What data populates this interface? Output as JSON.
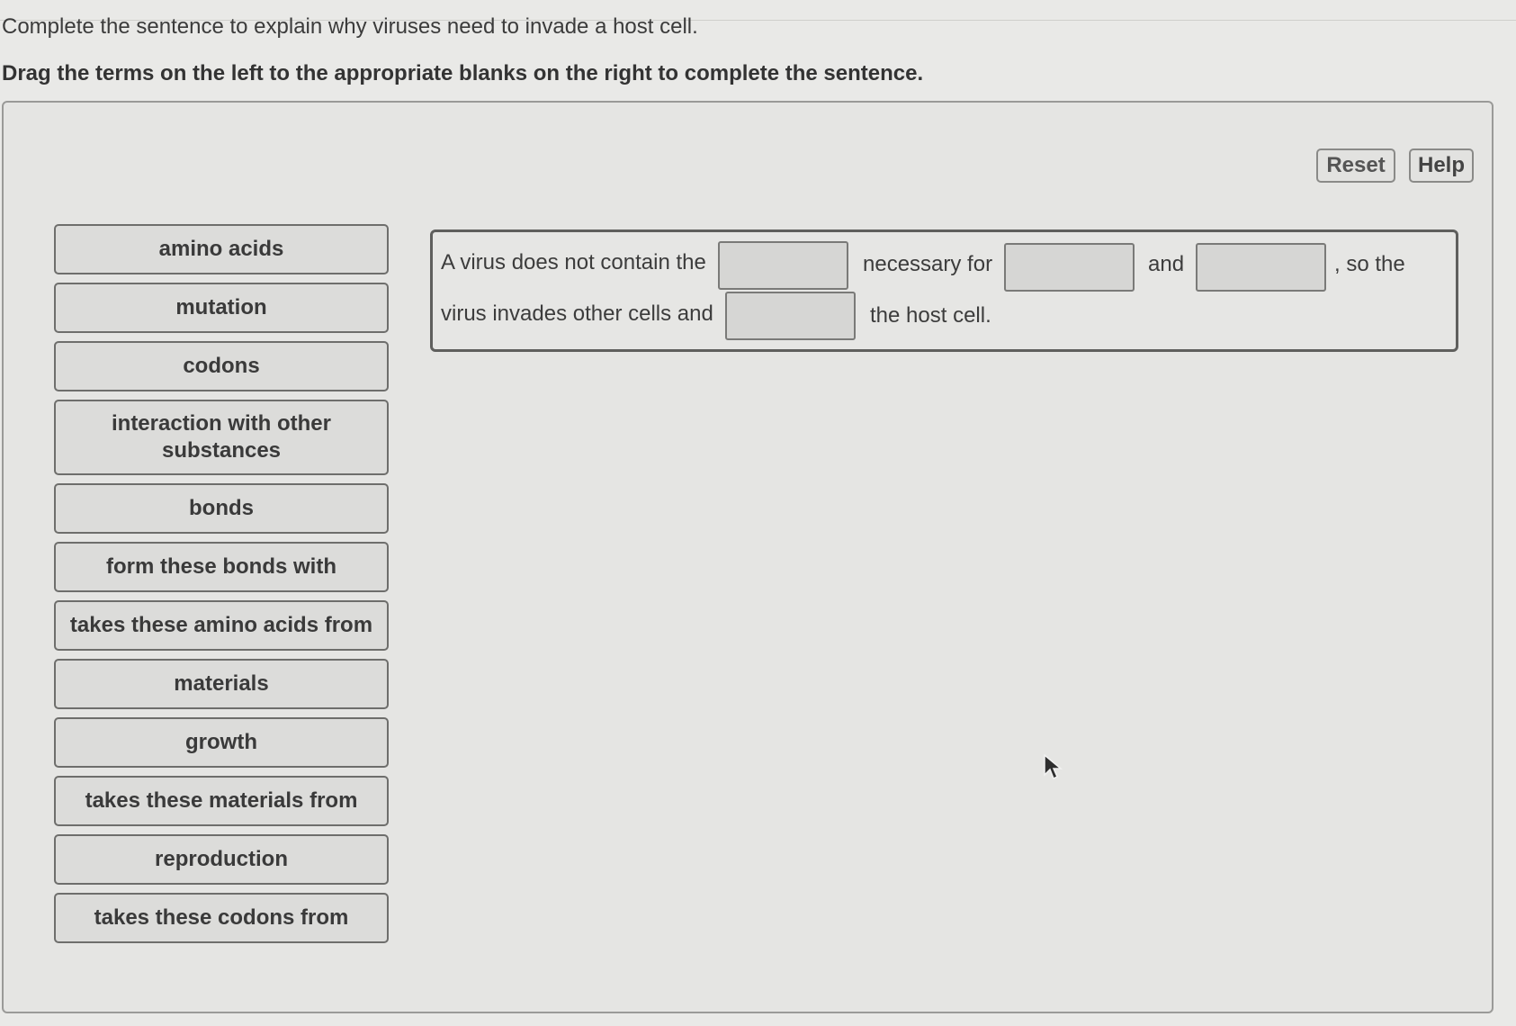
{
  "header": {
    "question": "Complete the sentence to explain why viruses need to invade a host cell.",
    "instructions": "Drag the terms on the left to the appropriate blanks on the right to complete the sentence."
  },
  "toolbar": {
    "reset_label": "Reset",
    "help_label": "Help"
  },
  "terms": [
    "amino acids",
    "mutation",
    "codons",
    "interaction with other substances",
    "bonds",
    "form these bonds with",
    "takes these amino acids from",
    "materials",
    "growth",
    "takes these materials from",
    "reproduction",
    "takes these codons from"
  ],
  "sentence": {
    "part1": "A virus does not contain the",
    "part2": "necessary for",
    "part3": "and",
    "part4": ", so the",
    "part5": "virus invades other cells and",
    "part6": "the host cell.",
    "blanks": [
      "",
      "",
      "",
      ""
    ]
  }
}
